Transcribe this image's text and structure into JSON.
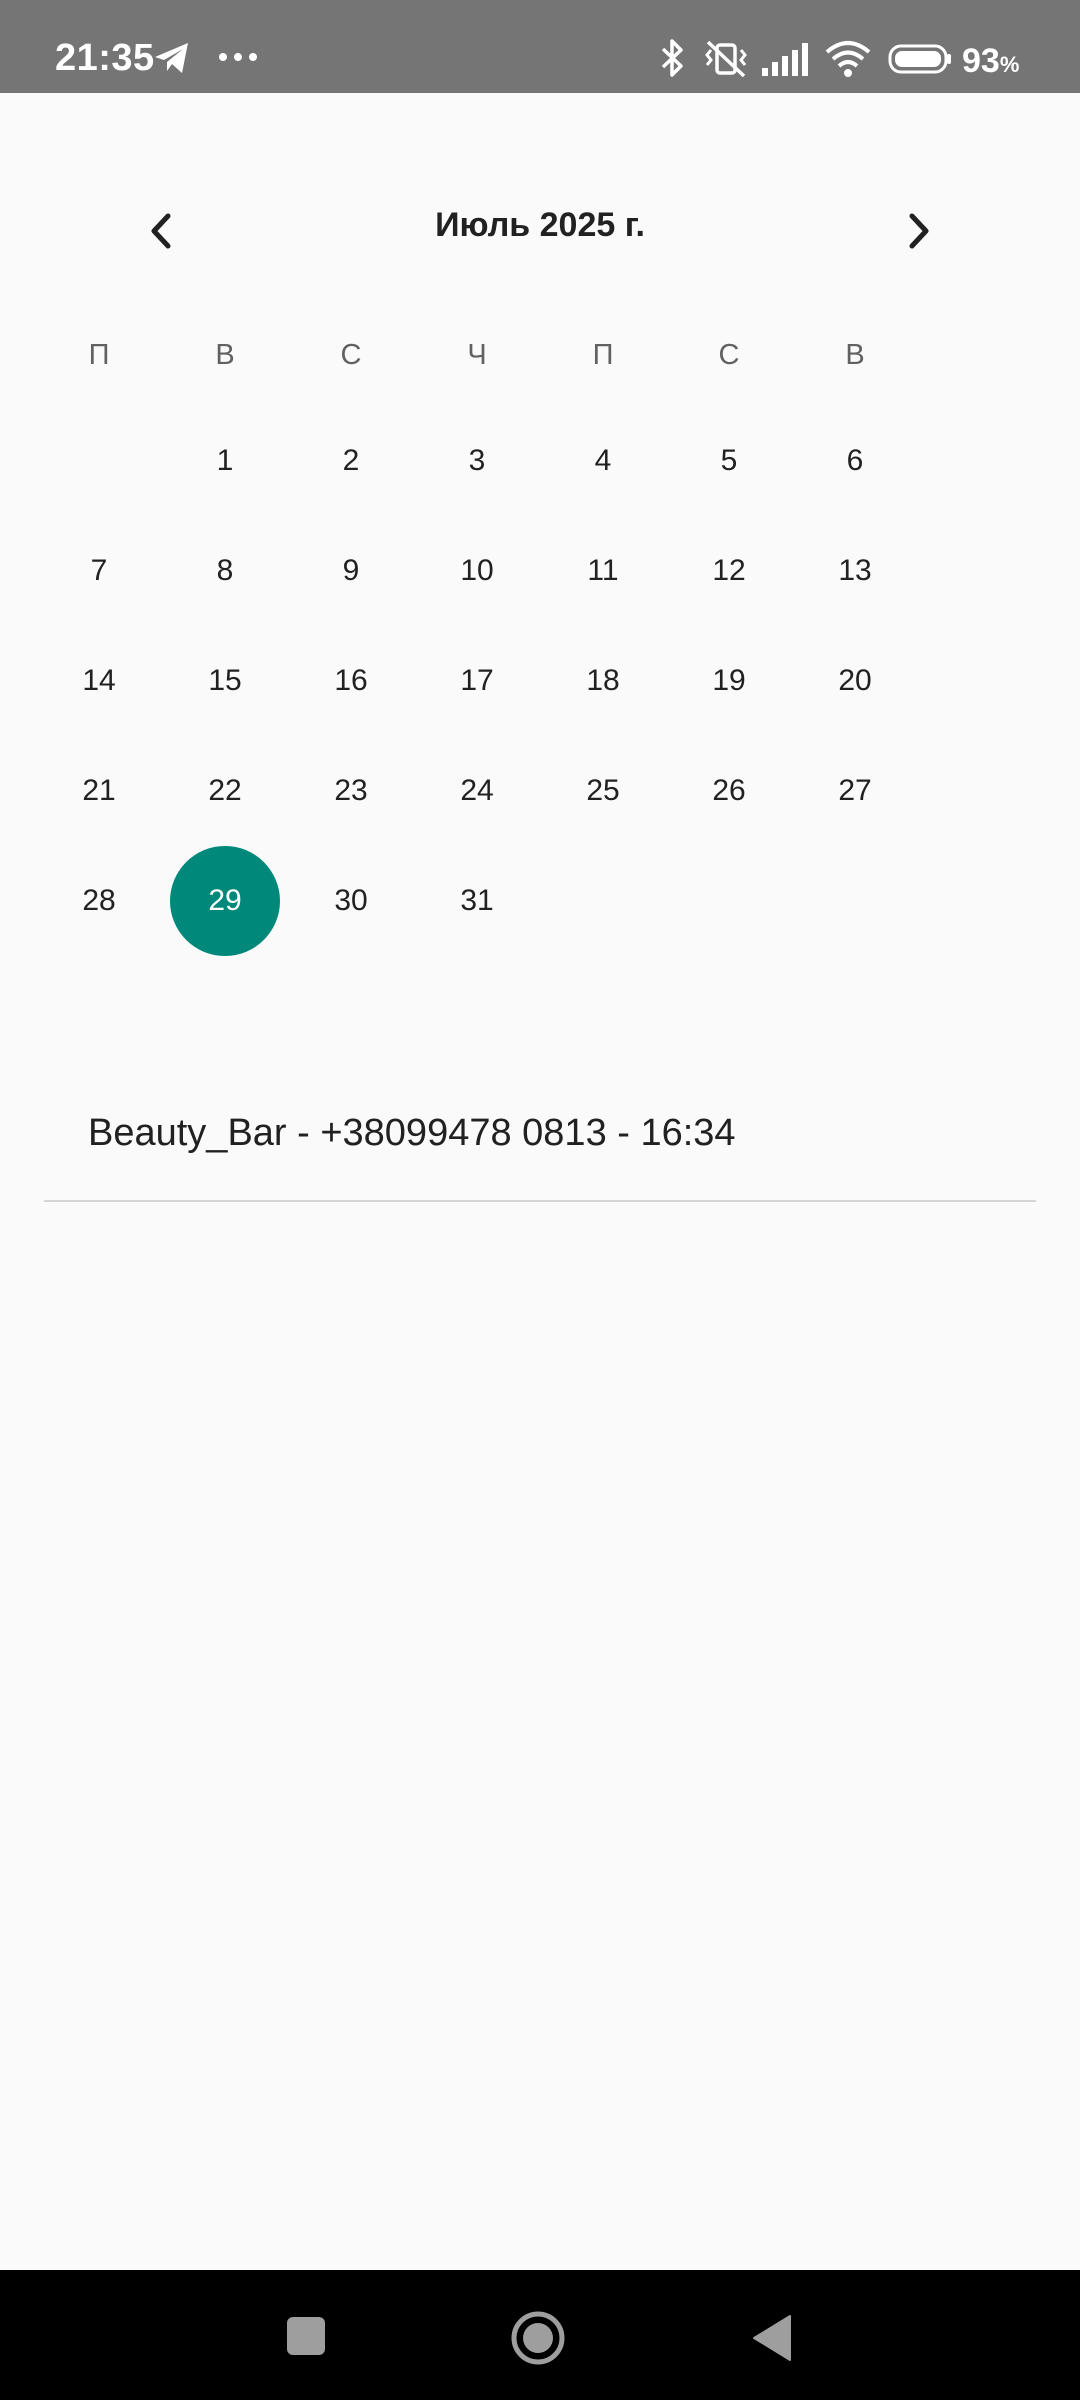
{
  "status_bar": {
    "time": "21:35",
    "battery": "93",
    "battery_unit": "%",
    "icons": [
      "telegram-icon",
      "more-dots-icon",
      "bluetooth-icon",
      "vibrate-off-icon",
      "signal-icon",
      "wifi-icon",
      "battery-icon"
    ]
  },
  "calendar": {
    "month_title": "Июль 2025 г.",
    "weekdays": [
      "П",
      "В",
      "С",
      "Ч",
      "П",
      "С",
      "В"
    ],
    "weeks": [
      [
        "",
        "1",
        "2",
        "3",
        "4",
        "5",
        "6"
      ],
      [
        "7",
        "8",
        "9",
        "10",
        "11",
        "12",
        "13"
      ],
      [
        "14",
        "15",
        "16",
        "17",
        "18",
        "19",
        "20"
      ],
      [
        "21",
        "22",
        "23",
        "24",
        "25",
        "26",
        "27"
      ],
      [
        "28",
        "29",
        "30",
        "31",
        "",
        "",
        ""
      ]
    ],
    "selected_day": "29",
    "accent_color": "#00897b"
  },
  "events": [
    {
      "text": "Beauty_Bar - +38099478 0813 - 16:34"
    }
  ],
  "nav_bar": {
    "buttons": [
      "recents-button",
      "home-button",
      "back-button"
    ]
  }
}
